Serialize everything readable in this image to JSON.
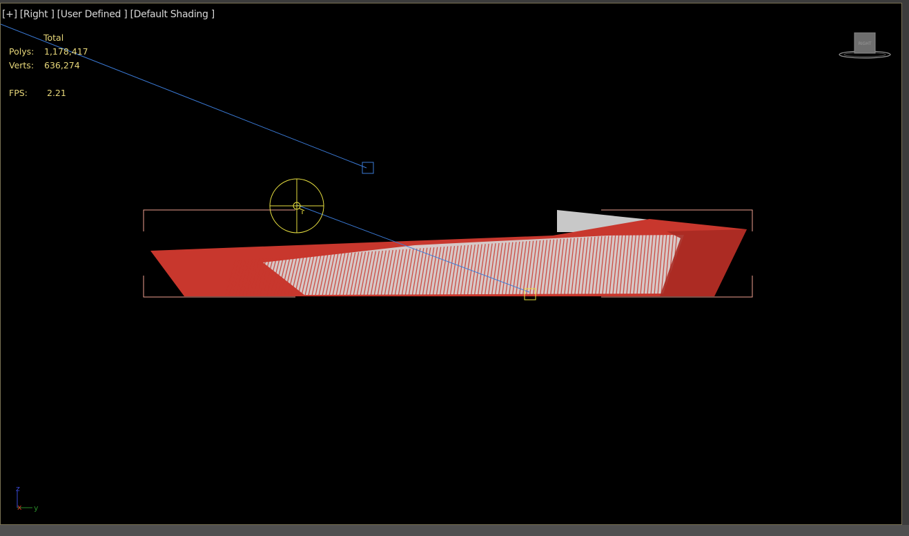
{
  "viewport": {
    "labels": [
      "[+]",
      "[Right ]",
      "[User Defined ]",
      "[Default Shading ]"
    ]
  },
  "stats": {
    "header": "Total",
    "polys_label": "Polys:",
    "polys_value": "1,178,417",
    "verts_label": "Verts:",
    "verts_value": "636,274",
    "fps_label": "FPS:",
    "fps_value": "2.21"
  },
  "viewcube": {
    "face_label": "RIGHT"
  },
  "axes": {
    "z": "z",
    "x": "x",
    "y": "y"
  },
  "colors": {
    "background": "#000000",
    "stats_text": "#e8d87a",
    "mesh_red": "#c8372d",
    "mesh_white": "#d0d0d0",
    "camera_line": "#3b7bd8",
    "light_gizmo": "#e8e040",
    "bbox": "#f0a090"
  },
  "icons": {
    "viewcube": "viewcube-icon",
    "axis": "axis-tripod-icon",
    "light": "light-gizmo-icon",
    "camera_target": "camera-target-icon"
  }
}
